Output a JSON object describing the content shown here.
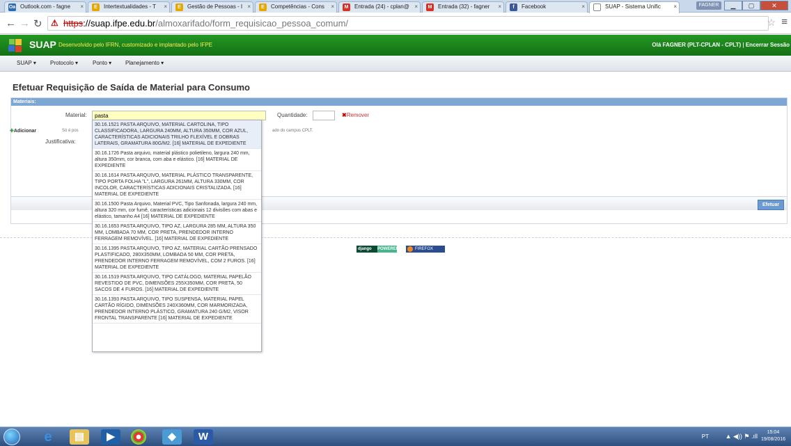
{
  "browser": {
    "tabs": [
      {
        "label": "Outlook.com - fagne",
        "icon": "Oa",
        "color": "#2d6ab4"
      },
      {
        "label": "Intertextualidades - T",
        "icon": "E",
        "color": "#e8a600"
      },
      {
        "label": "Gestão de Pessoas - I",
        "icon": "E",
        "color": "#e8a600"
      },
      {
        "label": "Competências - Cons",
        "icon": "E",
        "color": "#e8a600"
      },
      {
        "label": "Entrada (24) - cplan@",
        "icon": "M",
        "color": "#d93025"
      },
      {
        "label": "Entrada (32) - fagner",
        "icon": "M",
        "color": "#d93025"
      },
      {
        "label": "Facebook",
        "icon": "f",
        "color": "#3b5998"
      },
      {
        "label": "SUAP - Sistema Unific",
        "icon": "",
        "color": "#ffffff"
      }
    ],
    "user_chip": "FAGNER",
    "url": {
      "scheme": "https",
      "rest_host": "://suap.ifpe.edu.br",
      "path": "/almoxarifado/form_requisicao_pessoa_comum/"
    }
  },
  "header": {
    "app_name": "SUAP",
    "tagline": "Desenvolvido pelo IFRN, customizado e implantado pelo IFPE",
    "user_greeting": "Olá FAGNER (PLT-CPLAN - CPLT)",
    "separator": "|",
    "logout": "Encerrar Sessão"
  },
  "nav": {
    "items": [
      "SUAP ▾",
      "Protocolo ▾",
      "Ponto ▾",
      "Planejamento ▾"
    ]
  },
  "page": {
    "title": "Efetuar Requisição de Saída de Material para Consumo",
    "fieldset_legend": "Materiais:",
    "material_label": "Material:",
    "material_value": "pasta",
    "quantity_label": "Quantidade:",
    "remove_label": "Remover",
    "add_label": "Adicionar",
    "hint_start": "Só é pos",
    "hint_end": "ado do campus CPLT.",
    "justification_label": "Justificativa:",
    "submit_label": "Efetuar"
  },
  "autocomplete": [
    "30.16.1521 PASTA ARQUIVO, MATERIAL CARTOLINA, TIPO CLASSIFICADORA, LARGURA 240MM, ALTURA 350MM, COR AZUL, CARACTERÍSTICAS ADICIONAIS TRILHO FLEXÍVEL E DOBRAS LATERAIS, GRAMATURA 80G/M2. [16] MATERIAL DE EXPEDIENTE",
    "30.16.1726 Pasta arquivo, material plástico polietileno, largura 240 mm, altura 350mm, cor branca, com aba e elástico. [16] MATERIAL DE EXPEDIENTE",
    "30.16.1614 PASTA ARQUIVO, MATERIAL PLÁSTICO TRANSPARENTE, TIPO PORTA FOLHA \"L\", LARGURA 261MM, ALTURA 330MM, COR INCOLOR, CARACTERÍSTICAS ADICIONAIS CRISTALIZADA. [16] MATERIAL DE EXPEDIENTE",
    "30.16.1500 Pasta Arquivo, Material PVC, Tipo Sanfonada, largura 240 mm, altura 320 mm, cor fumê, características adicionais 12 divisões com abas e elástico, tamanho A4 [16] MATERIAL DE EXPEDIENTE",
    "30.16.1653 PASTA ARQUIVO, TIPO AZ, LARGURA 285 MM, ALTURA 350 MM, LOMBADA 70 MM, COR PRETA, PRENDEDOR INTERNO FERRAGEM REMOVÍVEL. [16] MATERIAL DE EXPEDIENTE",
    "30.16.1395 PASTA ARQUIVO, TIPO AZ, MATERIAL CARTÃO PRENSADO PLASTIFICADO, 280X350MM, LOMBADA 50 MM, COR PRETA, PRENDEDOR INTERNO FERRAGEM REMOVÍVEL, COM 2 FUROS. [16] MATERIAL DE EXPEDIENTE",
    "30.16.1519 PASTA ARQUIVO, TIPO CATÁLOGO, MATERIAL PAPELÃO REVESTIDO DE PVC, DIMENSÕES 255X350MM, COR PRETA, 50 SACOS DE 4 FUROS. [16] MATERIAL DE EXPEDIENTE",
    "30.16.1393 PASTA ARQUIVO, TIPO SUSPENSA, MATERIAL PAPEL CARTÃO RÍGIDO, DIMENSÕES 240X360MM, COR MARMORIZADA, PRENDEDOR INTERNO PLÁSTICO, GRAMATURA 240 G/M2, VISOR FRONTAL TRANSPARENTE [16] MATERIAL DE EXPEDIENTE"
  ],
  "footer_badges": {
    "django": "django",
    "django_powered": "POWERED",
    "firefox": "FIREFOX"
  },
  "taskbar": {
    "lang": "PT",
    "tray_icons": "▲ ◀)) ⚑ .ıll",
    "time": "15:04",
    "date": "19/08/2016"
  },
  "colors": {
    "suap_green": "#1c8a1c",
    "fieldset_header": "#7ca6d3",
    "submit_button": "#6d9bd1",
    "material_input_bg": "#ffffc2"
  }
}
